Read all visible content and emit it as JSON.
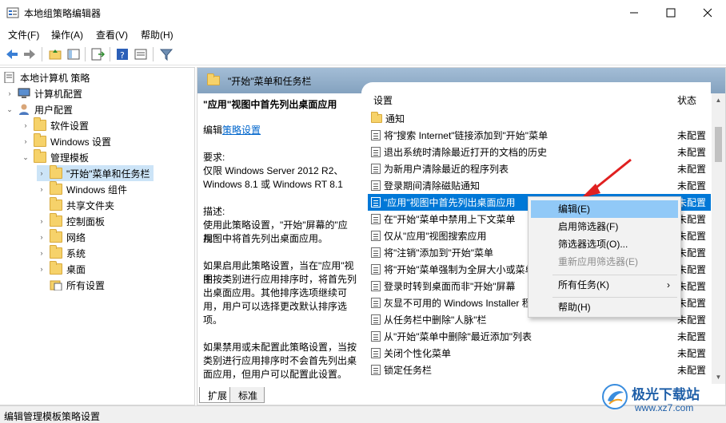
{
  "window": {
    "title": "本地组策略编辑器"
  },
  "menu": [
    "文件(F)",
    "操作(A)",
    "查看(V)",
    "帮助(H)"
  ],
  "tree": [
    {
      "label": "本地计算机 策略",
      "chev": "",
      "icon": "computer-policy-icon"
    },
    {
      "label": "计算机配置",
      "chev": "›",
      "icon": "computer-icon"
    },
    {
      "label": "用户配置",
      "chev": "⌄",
      "icon": "user-icon"
    },
    {
      "label": "软件设置",
      "chev": "›",
      "icon": "folder-icon"
    },
    {
      "label": "Windows 设置",
      "chev": "›",
      "icon": "folder-icon"
    },
    {
      "label": "管理模板",
      "chev": "⌄",
      "icon": "folder-icon"
    },
    {
      "label": "\"开始\"菜单和任务栏",
      "chev": "›",
      "icon": "folder-open-icon"
    },
    {
      "label": "Windows 组件",
      "chev": "›",
      "icon": "folder-icon"
    },
    {
      "label": "共享文件夹",
      "chev": "",
      "icon": "folder-icon"
    },
    {
      "label": "控制面板",
      "chev": "›",
      "icon": "folder-icon"
    },
    {
      "label": "网络",
      "chev": "›",
      "icon": "folder-icon"
    },
    {
      "label": "系统",
      "chev": "›",
      "icon": "folder-icon"
    },
    {
      "label": "桌面",
      "chev": "›",
      "icon": "folder-icon"
    },
    {
      "label": "所有设置",
      "chev": "",
      "icon": "all-settings-icon"
    }
  ],
  "panel": {
    "header": "\"开始\"菜单和任务栏",
    "desc_title": "\"应用\"视图中首先列出桌面应用",
    "edit_prefix": "编辑",
    "edit_link": "策略设置",
    "req_label": "要求:",
    "req_line1": "仅限 Windows Server 2012 R2、",
    "req_line2": "Windows 8.1 或 Windows RT 8.1",
    "desc_label": "描述:",
    "desc_p1_l1": "使用此策略设置，\"开始\"屏幕的\"应用\"",
    "desc_p1_l2": "视图中将首先列出桌面应用。",
    "desc_p2_l1": "如果启用此策略设置，当在\"应用\"视图",
    "desc_p2_l2": "中按类别进行应用排序时，将首先列",
    "desc_p2_l3": "出桌面应用。其他排序选项继续可",
    "desc_p2_l4": "用，用户可以选择更改默认排序选",
    "desc_p2_l5": "项。",
    "desc_p3_l1": "如果禁用或未配置此策略设置，当按",
    "desc_p3_l2": "类别进行应用排序时不会首先列出桌",
    "desc_p3_l3": "面应用，但用户可以配置此设置。"
  },
  "list": {
    "col_setting": "设置",
    "col_state": "状态",
    "folder_label": "通知",
    "rows": [
      {
        "name": "将\"搜索 Internet\"链接添加到\"开始\"菜单",
        "state": "未配置"
      },
      {
        "name": "退出系统时清除最近打开的文档的历史",
        "state": "未配置"
      },
      {
        "name": "为新用户清除最近的程序列表",
        "state": "未配置"
      },
      {
        "name": "登录期间清除磁贴通知",
        "state": "未配置"
      },
      {
        "name": "\"应用\"视图中首先列出桌面应用",
        "state": "未配置"
      },
      {
        "name": "在\"开始\"菜单中禁用上下文菜单",
        "state": "未配置"
      },
      {
        "name": "仅从\"应用\"视图搜索应用",
        "state": "未配置"
      },
      {
        "name": "将\"注销\"添加到\"开始\"菜单",
        "state": "未配置"
      },
      {
        "name": "将\"开始\"菜单强制为全屏大小或菜单",
        "state": "未配置"
      },
      {
        "name": "登录时转到桌面而非\"开始\"屏幕",
        "state": "未配置"
      },
      {
        "name": "灰显不可用的 Windows Installer 程序",
        "state": "未配置"
      },
      {
        "name": "从任务栏中删除\"人脉\"栏",
        "state": "未配置"
      },
      {
        "name": "从\"开始\"菜单中删除\"最近添加\"列表",
        "state": "未配置"
      },
      {
        "name": "关闭个性化菜单",
        "state": "未配置"
      },
      {
        "name": "锁定任务栏",
        "state": "未配置"
      }
    ]
  },
  "context_menu": {
    "edit": "编辑(E)",
    "enable_filter": "启用筛选器(F)",
    "filter_options": "筛选器选项(O)...",
    "reapply_filter": "重新应用筛选器(E)",
    "all_tasks": "所有任务(K)",
    "help": "帮助(H)"
  },
  "tabs": {
    "extended": "扩展",
    "standard": "标准"
  },
  "status": "编辑管理模板策略设置",
  "watermark": {
    "brand": "极光下载站",
    "url": "www.xz7.com"
  },
  "colors": {
    "selection": "#0078d7",
    "menu_highlight": "#91c9f7",
    "header": "#8eaac4",
    "arrow": "#e02020"
  }
}
